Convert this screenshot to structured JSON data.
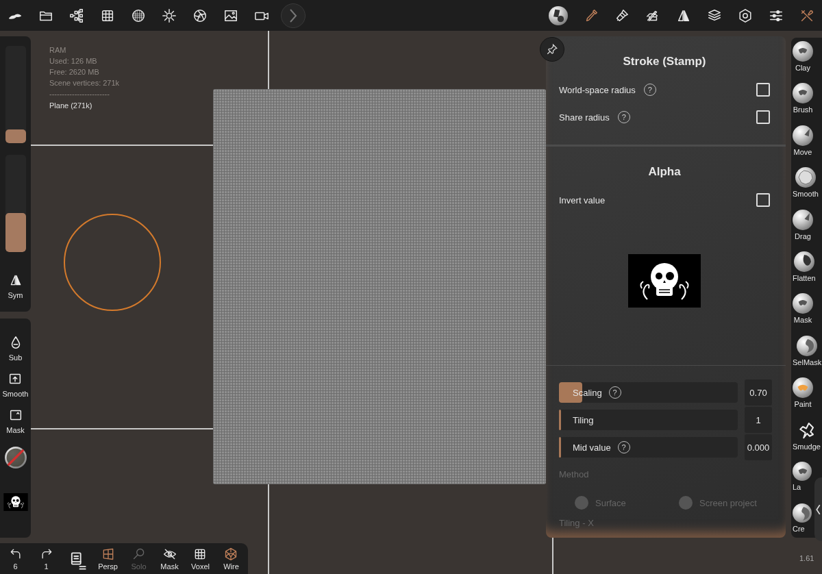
{
  "top_bar": {
    "left_tools": [
      {
        "kind": "logo"
      },
      {
        "kind": "folder"
      },
      {
        "kind": "scene"
      },
      {
        "kind": "grid"
      },
      {
        "kind": "mesh"
      },
      {
        "kind": "sun"
      },
      {
        "kind": "aperture"
      },
      {
        "kind": "image"
      },
      {
        "kind": "video"
      }
    ],
    "right_tools": [
      {
        "kind": "material",
        "selected": false
      },
      {
        "kind": "stroke",
        "selected": true
      },
      {
        "kind": "paint",
        "selected": false
      },
      {
        "kind": "hand",
        "selected": false
      },
      {
        "kind": "symmetry",
        "selected": false
      },
      {
        "kind": "layers",
        "selected": false
      },
      {
        "kind": "settings",
        "selected": false
      },
      {
        "kind": "sliders",
        "selected": false
      },
      {
        "kind": "tools",
        "selected": true
      }
    ]
  },
  "scene_info": {
    "lines": [
      "RAM",
      "Used: 126 MB",
      "Free: 2620 MB",
      "Scene vertices: 271k",
      "------------------------"
    ],
    "object": "Plane (271k)"
  },
  "left_panel": {
    "sliders": [
      {
        "level": 0.14
      },
      {
        "level": 0.4
      }
    ],
    "symmetry": {
      "label": "Sym"
    }
  },
  "left_tools": [
    {
      "kind": "sub",
      "label": "Sub"
    },
    {
      "kind": "smooth",
      "label": "Smooth"
    },
    {
      "kind": "mask",
      "label": "Mask"
    },
    {
      "kind": "material"
    },
    {
      "kind": "alpha"
    }
  ],
  "bottom_bar": [
    {
      "kind": "undo",
      "label": "6",
      "on": false,
      "disabled": false
    },
    {
      "kind": "redo",
      "label": "1",
      "on": false,
      "disabled": false
    },
    {
      "kind": "menu",
      "on": false,
      "disabled": false
    },
    {
      "kind": "persp",
      "label": "Persp",
      "on": true,
      "disabled": false
    },
    {
      "kind": "solo",
      "label": "Solo",
      "on": false,
      "disabled": true
    },
    {
      "kind": "mask",
      "label": "Mask",
      "on": false,
      "disabled": false
    },
    {
      "kind": "voxel",
      "label": "Voxel",
      "on": false,
      "disabled": false
    },
    {
      "kind": "wire",
      "label": "Wire",
      "on": true,
      "disabled": false
    }
  ],
  "panel": {
    "stroke_section": {
      "title": "Stroke (Stamp)",
      "options": [
        {
          "label": "World-space radius",
          "help": "?",
          "checked": false
        },
        {
          "label": "Share radius",
          "help": "?",
          "checked": false
        }
      ]
    },
    "alpha_section": {
      "title": "Alpha",
      "options": [
        {
          "label": "Invert value",
          "checked": false
        }
      ],
      "sliders": [
        {
          "label": "Scaling",
          "help": "?",
          "level": 0.13,
          "value": "0.70"
        },
        {
          "label": "Tiling",
          "level": 0,
          "value": "1"
        },
        {
          "label": "Mid value",
          "help": "?",
          "level": 0,
          "value": "0.000"
        }
      ],
      "method": {
        "label": "Method",
        "disabled": true,
        "options": [
          {
            "label": "Surface",
            "selected": false
          },
          {
            "label": "Screen project",
            "selected": false
          }
        ]
      },
      "next_label": "Tiling - X"
    }
  },
  "brushes": [
    {
      "kind": "clay",
      "label": "Clay"
    },
    {
      "kind": "clay",
      "label": "Brush"
    },
    {
      "kind": "move",
      "label": "Move"
    },
    {
      "kind": "smooth",
      "label": "Smooth"
    },
    {
      "kind": "move",
      "label": "Drag"
    },
    {
      "kind": "flatten",
      "label": "Flatten"
    },
    {
      "kind": "clay",
      "label": "Mask"
    },
    {
      "kind": "selmask",
      "label": "SelMask"
    },
    {
      "kind": "paint",
      "label": "Paint"
    },
    {
      "kind": "smudge",
      "label": "Smudge"
    },
    {
      "kind": "clay",
      "label": "La"
    },
    {
      "kind": "selmask",
      "label": "Cre"
    }
  ],
  "version": "1.61"
}
